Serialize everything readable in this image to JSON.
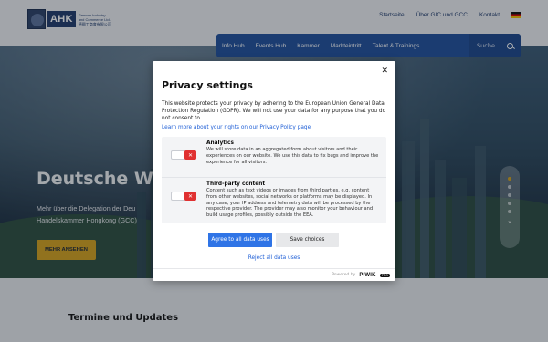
{
  "header": {
    "logo_abbr": "AHK",
    "logo_line1": "German Industry",
    "logo_line2": "and Commerce Ltd.",
    "logo_line3": "德國工商會有限公司",
    "links": [
      "Startseite",
      "Über GIC und GCC",
      "Kontakt"
    ]
  },
  "nav": {
    "items": [
      "Info Hub",
      "Events Hub",
      "Kammer",
      "Markteintritt",
      "Talent & Trainings"
    ],
    "search_label": "Suche"
  },
  "hero": {
    "title": "Deutsche Wirts",
    "subtitle_line1": "Mehr über die Delegation der Deu",
    "subtitle_line2": "Handelskammer Hongkong (GCC)",
    "button_label": "MEHR ANSEHEN"
  },
  "section": {
    "title": "Termine und Updates"
  },
  "modal": {
    "title": "Privacy settings",
    "description": "This website protects your privacy by adhering to the European Union General Data Protection Regulation (GDPR). We will not use your data for any purpose that you do not consent to.",
    "learn_more": "Learn more about your rights on our Privacy Policy page",
    "categories": [
      {
        "title": "Analytics",
        "description": "We will store data in an aggregated form about visitors and their experiences on our website. We use this data to fix bugs and improve the experience for all visitors.",
        "enabled": false
      },
      {
        "title": "Third-party content",
        "description": "Content such as text videos or images from third parties, e.g. content from other websites, social networks or platforms may be displayed. In any case, your IP address and telemetry data will be processed by the respective provider. The provider may also monitor your behaviour and build usage profiles, possibly outside the EEA.",
        "enabled": false
      }
    ],
    "agree_label": "Agree to all data uses",
    "save_label": "Save choices",
    "reject_label": "Reject all data uses",
    "powered_by": "Powered by",
    "brand": "PIWIK",
    "brand_badge": "PRO"
  },
  "colors": {
    "nav_blue": "#1f4f9c",
    "accent_gold": "#d4a21d",
    "primary_button": "#2f74e6",
    "toggle_off_red": "#e03131"
  }
}
